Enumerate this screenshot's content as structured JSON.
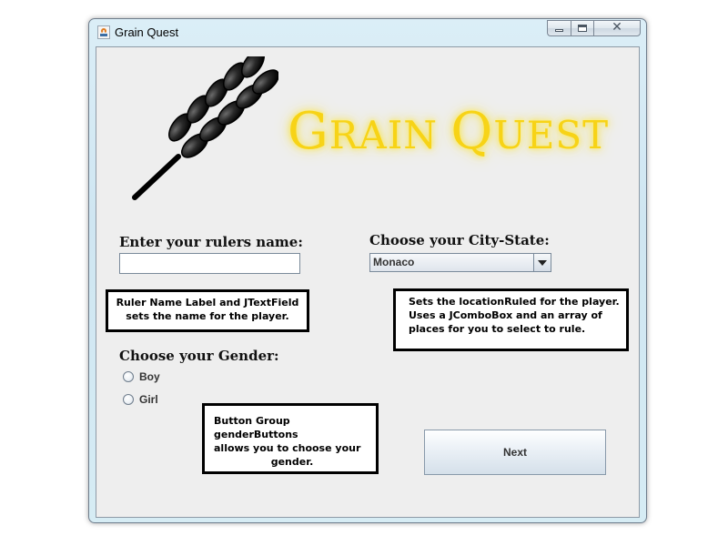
{
  "window": {
    "title": "Grain Quest",
    "caption_buttons": {
      "minimize_icon": "minimize-icon",
      "maximize_icon": "maximize-icon",
      "close_glyph": "✕"
    }
  },
  "logo": {
    "icon": "wheat-icon",
    "title_parts": [
      {
        "text": "G",
        "size": "big"
      },
      {
        "text": "RAIN ",
        "size": "small"
      },
      {
        "text": "Q",
        "size": "big"
      },
      {
        "text": "UEST",
        "size": "small"
      }
    ],
    "color": "#f7d316"
  },
  "form": {
    "ruler_label": "Enter your rulers name:",
    "ruler_value": "",
    "city_label": "Choose your City-State:",
    "city_selected": "Monaco",
    "gender_label": "Choose your Gender:",
    "gender_options": [
      "Boy",
      "Girl"
    ],
    "next_label": "Next"
  },
  "annotations": {
    "ruler": [
      "Ruler Name Label and JTextField",
      "sets the name for the player."
    ],
    "city": [
      "Sets the locationRuled for the player.",
      "Uses a JComboBox and an array of",
      "places for you to select to rule."
    ],
    "gender": [
      "Button Group genderButtons",
      "allows you to choose your",
      "gender."
    ]
  }
}
